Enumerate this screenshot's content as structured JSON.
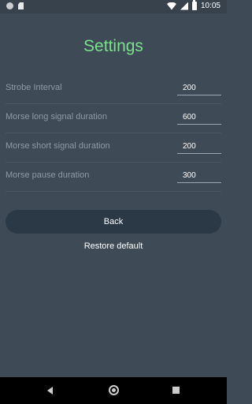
{
  "status_bar": {
    "time": "10:05",
    "icons": [
      "notification-dot-icon",
      "sd-card-icon",
      "wifi-icon",
      "signal-icon",
      "battery-icon"
    ]
  },
  "title": "Settings",
  "settings": [
    {
      "label": "Strobe Interval",
      "value": "200"
    },
    {
      "label": "Morse long signal duration",
      "value": "600"
    },
    {
      "label": "Morse short signal duration",
      "value": "200"
    },
    {
      "label": "Morse pause duration",
      "value": "300"
    }
  ],
  "buttons": {
    "back": "Back",
    "restore": "Restore default"
  },
  "nav_bar": {
    "icons": [
      "nav-back-icon",
      "nav-home-icon",
      "nav-recents-icon"
    ]
  },
  "colors": {
    "background": "#3e4b57",
    "title": "#7be08c",
    "button": "#2b3947"
  }
}
